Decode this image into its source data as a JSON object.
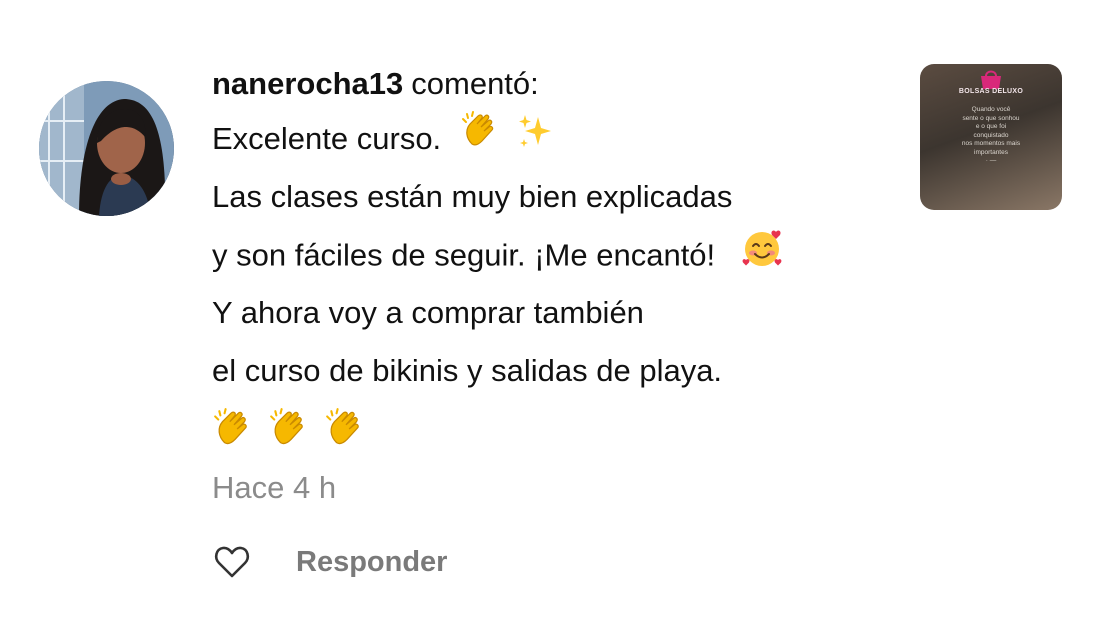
{
  "comment": {
    "username": "nanerocha13",
    "verb": "comentó:",
    "lines": [
      "Excelente curso.",
      "Las clases están muy bien explicadas",
      "y son fáciles de seguir. ¡Me encantó!",
      "Y ahora voy a comprar también",
      "el curso de bikinis y salidas de playa."
    ],
    "emojis": {
      "line1": [
        "clapping-hands-icon",
        "sparkles-icon"
      ],
      "line3": [
        "smiling-face-with-hearts-icon"
      ],
      "line6": [
        "clapping-hands-icon",
        "clapping-hands-icon",
        "clapping-hands-icon"
      ]
    },
    "timestamp": "Hace 4 h"
  },
  "actions": {
    "like_icon": "heart-outline-icon",
    "reply_label": "Responder"
  },
  "thumbnail": {
    "brand": "BOLSAS DELUXO",
    "text": "Quando você\nsente o que sonhou\ne o que foi\nconquistado\nnos momentos mais\nimportantes\n· —"
  },
  "colors": {
    "text": "#111111",
    "muted": "#8b8b8b",
    "reply": "#7a7a7a",
    "clap": "#f5b700",
    "brand_pink": "#d8287a"
  }
}
